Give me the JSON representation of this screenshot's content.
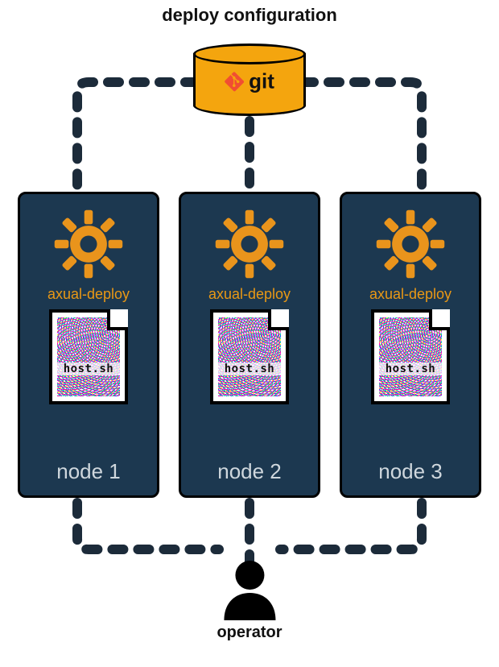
{
  "title": "deploy configuration",
  "git": {
    "label": "git"
  },
  "nodes": [
    {
      "deploy_label": "axual-deploy",
      "file_name": "host.sh",
      "title": "node 1"
    },
    {
      "deploy_label": "axual-deploy",
      "file_name": "host.sh",
      "title": "node 2"
    },
    {
      "deploy_label": "axual-deploy",
      "file_name": "host.sh",
      "title": "node 3"
    }
  ],
  "operator": {
    "label": "operator"
  }
}
